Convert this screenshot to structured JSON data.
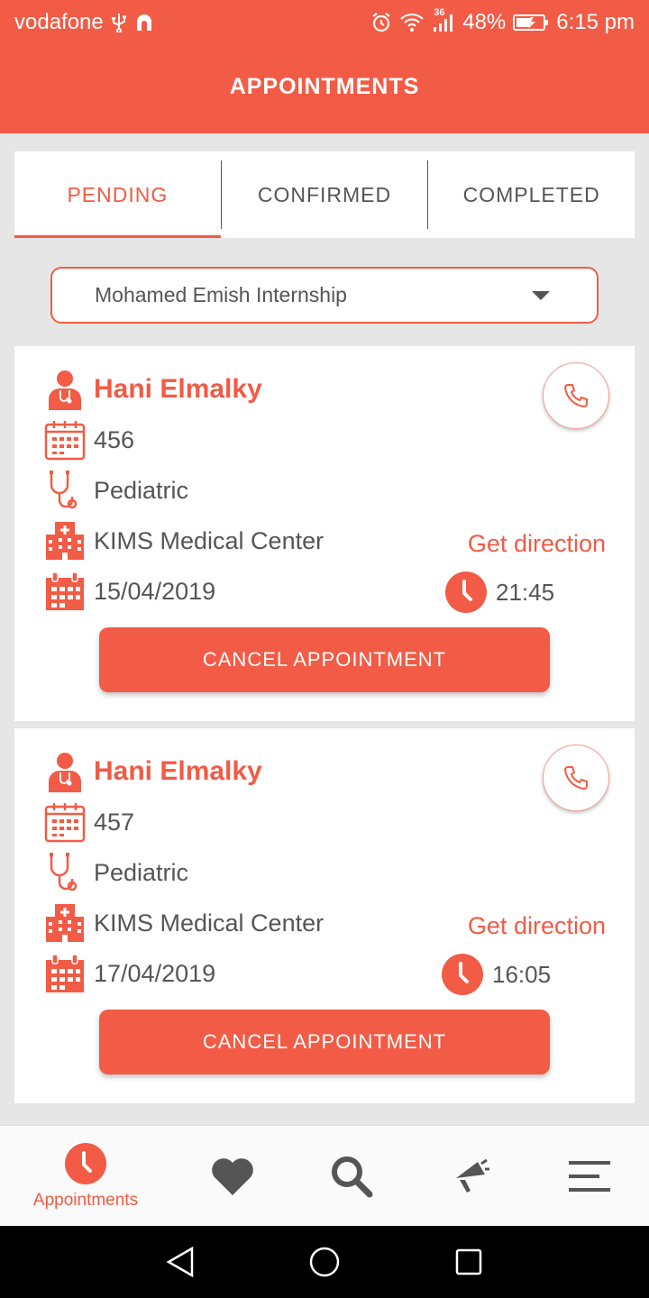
{
  "status_bar": {
    "carrier": "vodafone",
    "network": "36",
    "battery": "48%",
    "time": "6:15 pm"
  },
  "header": {
    "title": "APPOINTMENTS"
  },
  "tabs": [
    {
      "label": "PENDING",
      "active": true
    },
    {
      "label": "CONFIRMED",
      "active": false
    },
    {
      "label": "COMPLETED",
      "active": false
    }
  ],
  "filter": {
    "selected": "Mohamed Emish Internship"
  },
  "appointments": [
    {
      "doctor": "Hani Elmalky",
      "number": "456",
      "specialty": "Pediatric",
      "center": "KIMS Medical Center",
      "date": "15/04/2019",
      "time": "21:45",
      "direction_label": "Get direction",
      "cancel_label": "CANCEL APPOINTMENT"
    },
    {
      "doctor": "Hani Elmalky",
      "number": "457",
      "specialty": "Pediatric",
      "center": "KIMS Medical Center",
      "date": "17/04/2019",
      "time": "16:05",
      "direction_label": "Get direction",
      "cancel_label": "CANCEL APPOINTMENT"
    }
  ],
  "bottom_nav": {
    "items": [
      {
        "label": "Appointments",
        "icon": "clock-icon",
        "active": true
      },
      {
        "label": "",
        "icon": "heart-icon",
        "active": false
      },
      {
        "label": "",
        "icon": "search-icon",
        "active": false
      },
      {
        "label": "",
        "icon": "megaphone-icon",
        "active": false
      },
      {
        "label": "",
        "icon": "menu-icon",
        "active": false
      }
    ]
  },
  "colors": {
    "accent": "#f25b45",
    "text": "#555555",
    "background": "#e6e6e6"
  }
}
